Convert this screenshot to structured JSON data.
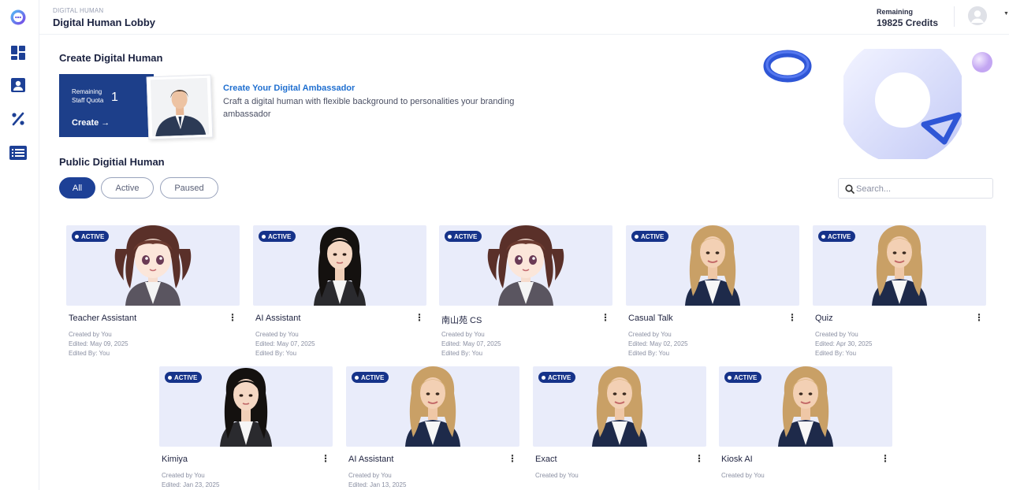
{
  "header": {
    "breadcrumb": "DIGITAL HUMAN",
    "title": "Digital Human Lobby",
    "credits_label": "Remaining",
    "credits_value": "19825 Credits"
  },
  "sidebar": {
    "items": [
      {
        "icon": "dashboard-icon"
      },
      {
        "icon": "person-card-icon"
      },
      {
        "icon": "percent-icon"
      },
      {
        "icon": "list-icon"
      }
    ]
  },
  "create_section": {
    "title": "Create Digital Human",
    "quota_label": "Remaining Staff Quota",
    "quota_value": "1",
    "create_label": "Create →",
    "ambassador_title": "Create Your Digital Ambassador",
    "ambassador_desc": "Craft a digital human with flexible background to personalities your branding ambassador"
  },
  "public_section": {
    "title": "Public Digitial Human",
    "filters": [
      "All",
      "Active",
      "Paused"
    ],
    "selected_filter": "All",
    "search_placeholder": "Search..."
  },
  "cards": [
    {
      "name": "Teacher Assistant",
      "status": "ACTIVE",
      "created": "Created by You",
      "edited": "Edited: May 09, 2025",
      "edited_by": "Edited By: You",
      "avatar": "anime-girl"
    },
    {
      "name": "AI Assistant",
      "status": "ACTIVE",
      "created": "Created by You",
      "edited": "Edited: May 07, 2025",
      "edited_by": "Edited By: You",
      "avatar": "asian-woman"
    },
    {
      "name": "南山苑 CS",
      "status": "ACTIVE",
      "created": "Created by You",
      "edited": "Edited: May 07, 2025",
      "edited_by": "Edited By: You",
      "avatar": "anime-girl"
    },
    {
      "name": "Casual Talk",
      "status": "ACTIVE",
      "created": "Created by You",
      "edited": "Edited: May 02, 2025",
      "edited_by": "Edited By: You",
      "avatar": "blonde-woman"
    },
    {
      "name": "Quiz",
      "status": "ACTIVE",
      "created": "Created by You",
      "edited": "Edited: Apr 30, 2025",
      "edited_by": "Edited By: You",
      "avatar": "blonde-woman"
    },
    {
      "name": "Kimiya",
      "status": "ACTIVE",
      "created": "Created by You",
      "edited": "Edited: Jan 23, 2025",
      "edited_by": "",
      "avatar": "asian-woman"
    },
    {
      "name": "AI Assistant",
      "status": "ACTIVE",
      "created": "Created by You",
      "edited": "Edited: Jan 13, 2025",
      "edited_by": "",
      "avatar": "blonde-woman"
    },
    {
      "name": "Exact",
      "status": "ACTIVE",
      "created": "Created by You",
      "edited": "",
      "edited_by": "",
      "avatar": "blonde-woman"
    },
    {
      "name": "Kiosk AI",
      "status": "ACTIVE",
      "created": "Created by You",
      "edited": "",
      "edited_by": "",
      "avatar": "blonde-woman"
    }
  ],
  "colors": {
    "primary": "#1d4096",
    "accent_link": "#1f6fd0",
    "thumb_bg": "#e9ecfa",
    "badge": "#16338a"
  }
}
